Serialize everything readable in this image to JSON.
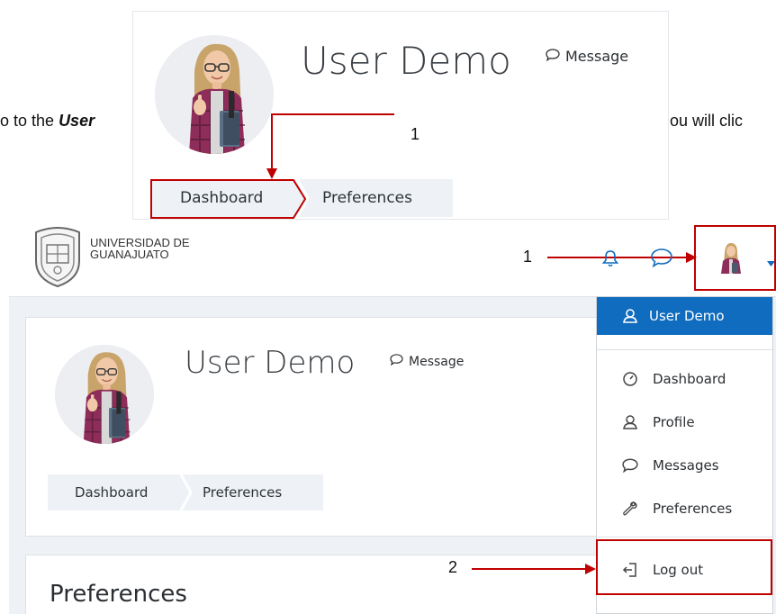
{
  "doc": {
    "left_fragment_prefix": "o to the ",
    "left_fragment_bold": "User",
    "right_fragment": "ou will clic"
  },
  "inset": {
    "user_name": "User Demo",
    "message_label": "Message",
    "breadcrumbs": [
      "Dashboard",
      "Preferences"
    ],
    "annotation": "1"
  },
  "main": {
    "brand_line1": "UNIVERSIDAD DE",
    "brand_line2": "GUANAJUATO",
    "annotation_1": "1",
    "annotation_2": "2",
    "user_name": "User Demo",
    "message_label": "Message",
    "breadcrumbs": [
      "Dashboard",
      "Preferences"
    ],
    "section_title": "Preferences",
    "menu": {
      "header": "User Demo",
      "items": [
        "Dashboard",
        "Profile",
        "Messages",
        "Preferences"
      ],
      "logout": "Log out"
    }
  },
  "colors": {
    "accent": "#0f6cbf",
    "annotation_red": "#c00000",
    "breadcrumb_bg": "#eef2f6",
    "content_bg": "#eef2f6"
  }
}
